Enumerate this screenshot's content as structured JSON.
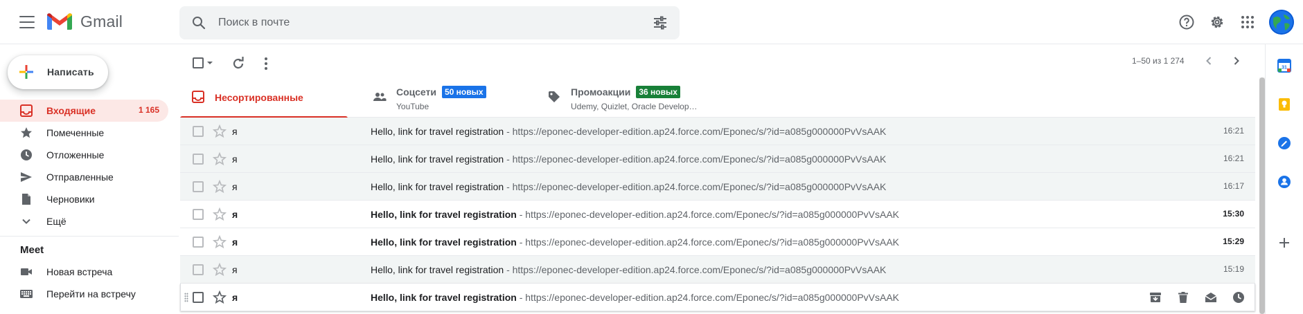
{
  "header": {
    "app_name": "Gmail",
    "search_placeholder": "Поиск в почте"
  },
  "sidebar": {
    "compose_label": "Написать",
    "items": [
      {
        "label": "Входящие",
        "count": "1 165",
        "icon": "inbox-icon",
        "active": true
      },
      {
        "label": "Помеченные",
        "icon": "star-icon"
      },
      {
        "label": "Отложенные",
        "icon": "clock-icon"
      },
      {
        "label": "Отправленные",
        "icon": "send-icon"
      },
      {
        "label": "Черновики",
        "icon": "draft-icon"
      },
      {
        "label": "Ещё",
        "icon": "chevron-down-icon"
      }
    ],
    "meet": {
      "title": "Meet",
      "items": [
        {
          "label": "Новая встреча",
          "icon": "video-icon"
        },
        {
          "label": "Перейти на встречу",
          "icon": "keyboard-icon"
        }
      ]
    }
  },
  "toolbar": {
    "paging": "1–50 из 1 274"
  },
  "tabs": [
    {
      "label": "Несортированные",
      "icon": "inbox-icon",
      "active": true
    },
    {
      "label": "Соцсети",
      "badge": "50 новых",
      "badge_color": "#1a73e8",
      "sub": "YouTube",
      "icon": "people-icon"
    },
    {
      "label": "Промоакции",
      "badge": "36 новых",
      "badge_color": "#188038",
      "sub": "Udemy, Quizlet, Oracle Develop…",
      "icon": "tag-icon"
    }
  ],
  "emails": [
    {
      "sender": "я",
      "subject": "Hello, link for travel registration",
      "snippet": " - https://eponec-developer-edition.ap24.force.com/Eponec/s/?id=a085g000000PvVsAAK",
      "time": "16:21",
      "unread": false
    },
    {
      "sender": "я",
      "subject": "Hello, link for travel registration",
      "snippet": " - https://eponec-developer-edition.ap24.force.com/Eponec/s/?id=a085g000000PvVsAAK",
      "time": "16:21",
      "unread": false
    },
    {
      "sender": "я",
      "subject": "Hello, link for travel registration",
      "snippet": " - https://eponec-developer-edition.ap24.force.com/Eponec/s/?id=a085g000000PvVsAAK",
      "time": "16:17",
      "unread": false
    },
    {
      "sender": "я",
      "subject": "Hello, link for travel registration",
      "snippet": " - https://eponec-developer-edition.ap24.force.com/Eponec/s/?id=a085g000000PvVsAAK",
      "time": "15:30",
      "unread": true
    },
    {
      "sender": "я",
      "subject": "Hello, link for travel registration",
      "snippet": " - https://eponec-developer-edition.ap24.force.com/Eponec/s/?id=a085g000000PvVsAAK",
      "time": "15:29",
      "unread": true
    },
    {
      "sender": "я",
      "subject": "Hello, link for travel registration",
      "snippet": " - https://eponec-developer-edition.ap24.force.com/Eponec/s/?id=a085g000000PvVsAAK",
      "time": "15:19",
      "unread": false
    },
    {
      "sender": "я",
      "subject": "Hello, link for travel registration",
      "snippet": " - https://eponec-developer-edition.ap24.force.com/Eponec/s/?id=a085g000000PvVsAAK",
      "time": "",
      "unread": true,
      "hover": true
    }
  ],
  "side_panel": {
    "calendar_day": "31",
    "icons": [
      "calendar-icon",
      "keep-icon",
      "tasks-icon",
      "contacts-icon",
      "add-icon"
    ]
  },
  "colors": {
    "accent_red": "#d93025",
    "active_bg": "#fce8e6",
    "social_badge": "#1a73e8",
    "promo_badge": "#188038"
  }
}
